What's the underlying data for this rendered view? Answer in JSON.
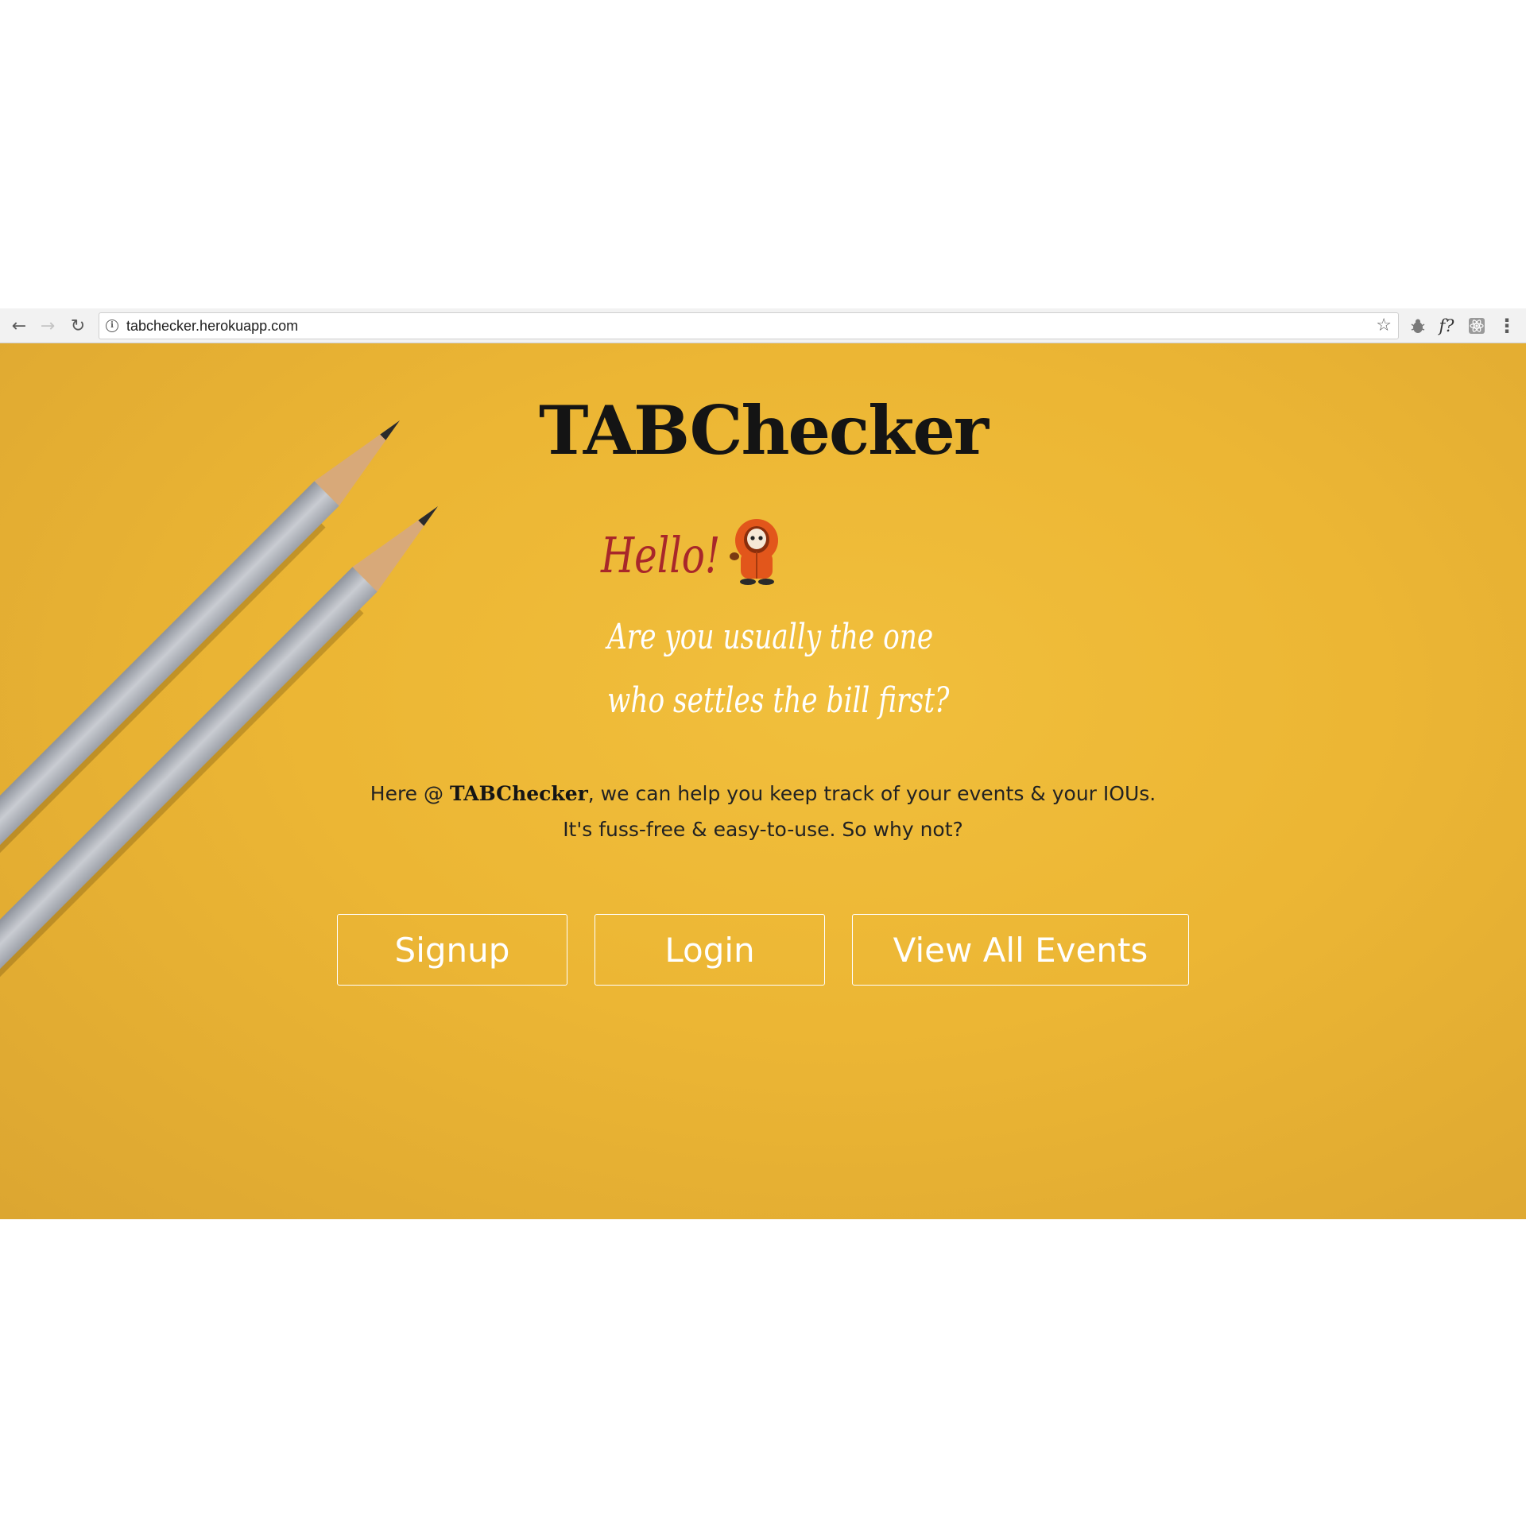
{
  "browser": {
    "url": "tabchecker.herokuapp.com",
    "back_icon": "←",
    "forward_icon": "→",
    "reload_icon": "↻",
    "star_icon": "☆",
    "menu_icon": "⋮",
    "ext_fx_label": "f?"
  },
  "hero": {
    "logo": "TABChecker",
    "greeting": "Hello!",
    "tagline_line1": "Are you usually the one",
    "tagline_line2": "who settles the bill first?",
    "desc_prefix": "Here @ ",
    "desc_brand": "TABChecker",
    "desc_suffix": ", we can help you keep track of your events & your IOUs.",
    "desc_line2": "It's fuss-free & easy-to-use. So why not?",
    "buttons": {
      "signup": "Signup",
      "login": "Login",
      "view_events": "View All Events"
    }
  },
  "colors": {
    "background": "#ecb634",
    "greeting": "#a8272a",
    "logo": "#141414",
    "button_border": "#ffffff"
  }
}
